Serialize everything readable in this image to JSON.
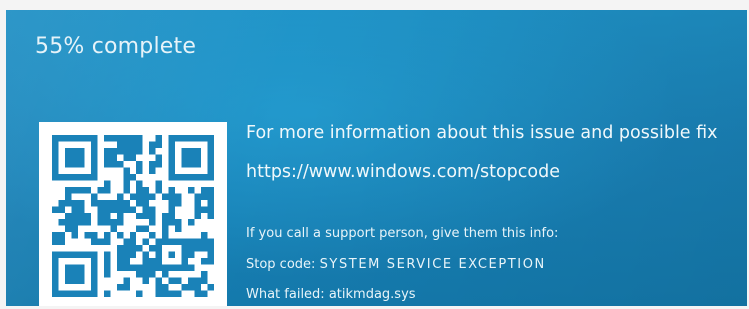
{
  "progress": {
    "text": "55% complete",
    "percent": 55
  },
  "info": {
    "more_info_text": "For more information about this issue and possible fix",
    "url": "https://www.windows.com/stopcode"
  },
  "support": {
    "call_text": "If you call a support person, give them this info:",
    "stop_code_label": "Stop code: ",
    "stop_code": "SYSTEM SERVICE EXCEPTION",
    "what_failed_label": "What failed: ",
    "what_failed": "atikmdag.sys"
  },
  "qr_code": {
    "icon": "qr-code"
  },
  "colors": {
    "background": "#1a82b8",
    "text": "#f0f8fb",
    "qr_background": "#ffffff"
  }
}
